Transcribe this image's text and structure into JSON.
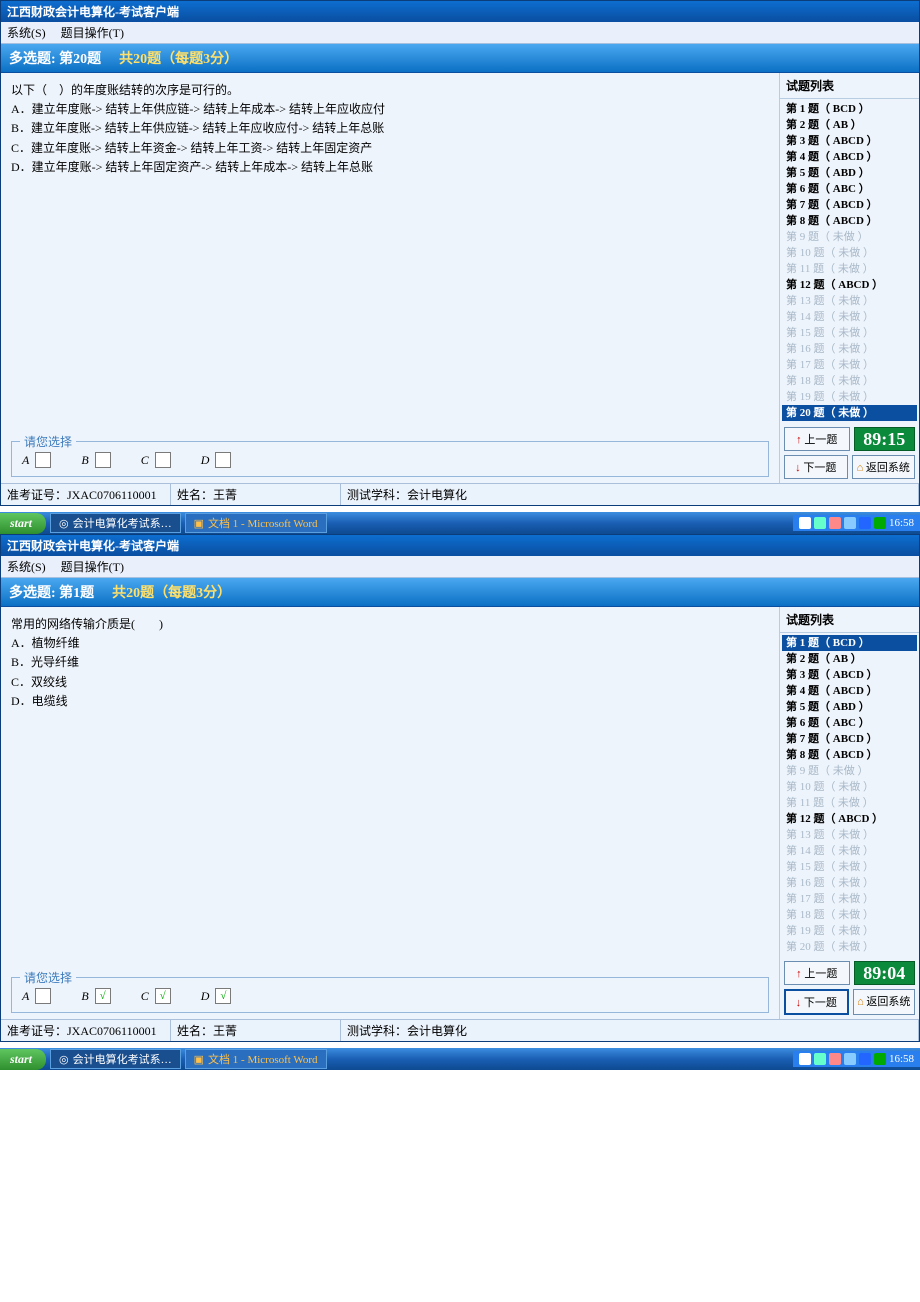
{
  "app_title": "江西财政会计电算化-考试客户端",
  "menu": {
    "system": "系统(S)",
    "operate": "题目操作(T)"
  },
  "screen1": {
    "header": {
      "prefix": "多选题:",
      "qno": "第20题",
      "total": "共20题（每题3分）"
    },
    "question_stem": "以下（　）的年度账结转的次序是可行的。",
    "options": {
      "a": "A．建立年度账-> 结转上年供应链-> 结转上年成本-> 结转上年应收应付",
      "b": "B．建立年度账-> 结转上年供应链-> 结转上年应收应付-> 结转上年总账",
      "c": "C．建立年度账-> 结转上年资金-> 结转上年工资-> 结转上年固定资产",
      "d": "D．建立年度账-> 结转上年固定资产-> 结转上年成本-> 结转上年总账"
    },
    "choice_legend": "请您选择",
    "labels": {
      "a": "A",
      "b": "B",
      "c": "C",
      "d": "D"
    },
    "checked": {
      "a": false,
      "b": false,
      "c": false,
      "d": false
    },
    "list_title": "试题列表",
    "qlist": [
      {
        "text": "第  1 题（ BCD ）",
        "state": "done"
      },
      {
        "text": "第  2 题（ AB ）",
        "state": "done"
      },
      {
        "text": "第  3 题（ ABCD ）",
        "state": "done"
      },
      {
        "text": "第  4 题（ ABCD ）",
        "state": "done"
      },
      {
        "text": "第  5 题（ ABD ）",
        "state": "done"
      },
      {
        "text": "第  6 题（ ABC ）",
        "state": "done"
      },
      {
        "text": "第  7 题（ ABCD ）",
        "state": "done"
      },
      {
        "text": "第  8 题（ ABCD ）",
        "state": "done"
      },
      {
        "text": "第  9 题（ 未做 ）",
        "state": "pending"
      },
      {
        "text": "第 10 题（ 未做 ）",
        "state": "pending"
      },
      {
        "text": "第 11 题（ 未做 ）",
        "state": "pending"
      },
      {
        "text": "第 12 题（ ABCD ）",
        "state": "done"
      },
      {
        "text": "第 13 题（ 未做 ）",
        "state": "pending"
      },
      {
        "text": "第 14 题（ 未做 ）",
        "state": "pending"
      },
      {
        "text": "第 15 题（ 未做 ）",
        "state": "pending"
      },
      {
        "text": "第 16 题（ 未做 ）",
        "state": "pending"
      },
      {
        "text": "第 17 题（ 未做 ）",
        "state": "pending"
      },
      {
        "text": "第 18 题（ 未做 ）",
        "state": "pending"
      },
      {
        "text": "第 19 题（ 未做 ）",
        "state": "pending"
      },
      {
        "text": "第 20 题（ 未做 ）",
        "state": "selected"
      }
    ],
    "btn_prev": "上一题",
    "btn_next": "下一题",
    "btn_exit": "返回系统",
    "timer": "89:15",
    "status": {
      "id_label": "准考证号：",
      "id_value": "JXAC0706110001",
      "name_label": "姓名：",
      "name_value": "王菁",
      "subj_label": "测试学科：",
      "subj_value": "会计电算化"
    }
  },
  "screen2": {
    "header": {
      "prefix": "多选题:",
      "qno": "第1题",
      "total": "共20题（每题3分）"
    },
    "question_stem": "常用的网络传输介质是(　　)",
    "options": {
      "a": "A．植物纤维",
      "b": "B．光导纤维",
      "c": "C．双绞线",
      "d": "D．电缆线"
    },
    "choice_legend": "请您选择",
    "labels": {
      "a": "A",
      "b": "B",
      "c": "C",
      "d": "D"
    },
    "checked": {
      "a": false,
      "b": true,
      "c": true,
      "d": true
    },
    "list_title": "试题列表",
    "qlist": [
      {
        "text": "第  1 题（ BCD ）",
        "state": "selected"
      },
      {
        "text": "第  2 题（ AB ）",
        "state": "done"
      },
      {
        "text": "第  3 题（ ABCD ）",
        "state": "done"
      },
      {
        "text": "第  4 题（ ABCD ）",
        "state": "done"
      },
      {
        "text": "第  5 题（ ABD ）",
        "state": "done"
      },
      {
        "text": "第  6 题（ ABC ）",
        "state": "done"
      },
      {
        "text": "第  7 题（ ABCD ）",
        "state": "done"
      },
      {
        "text": "第  8 题（ ABCD ）",
        "state": "done"
      },
      {
        "text": "第  9 题（ 未做 ）",
        "state": "pending"
      },
      {
        "text": "第 10 题（ 未做 ）",
        "state": "pending"
      },
      {
        "text": "第 11 题（ 未做 ）",
        "state": "pending"
      },
      {
        "text": "第 12 题（ ABCD ）",
        "state": "done"
      },
      {
        "text": "第 13 题（ 未做 ）",
        "state": "pending"
      },
      {
        "text": "第 14 题（ 未做 ）",
        "state": "pending"
      },
      {
        "text": "第 15 题（ 未做 ）",
        "state": "pending"
      },
      {
        "text": "第 16 题（ 未做 ）",
        "state": "pending"
      },
      {
        "text": "第 17 题（ 未做 ）",
        "state": "pending"
      },
      {
        "text": "第 18 题（ 未做 ）",
        "state": "pending"
      },
      {
        "text": "第 19 题（ 未做 ）",
        "state": "pending"
      },
      {
        "text": "第 20 题（ 未做 ）",
        "state": "pending"
      }
    ],
    "btn_prev": "上一题",
    "btn_next": "下一题",
    "btn_exit": "返回系统",
    "timer": "89:04",
    "status": {
      "id_label": "准考证号：",
      "id_value": "JXAC0706110001",
      "name_label": "姓名：",
      "name_value": "王菁",
      "subj_label": "测试学科：",
      "subj_value": "会计电算化"
    }
  },
  "taskbar": {
    "start": "start",
    "task1": "会计电算化考试系…",
    "task2": "文档 1 - Microsoft Word",
    "time": "16:58"
  }
}
